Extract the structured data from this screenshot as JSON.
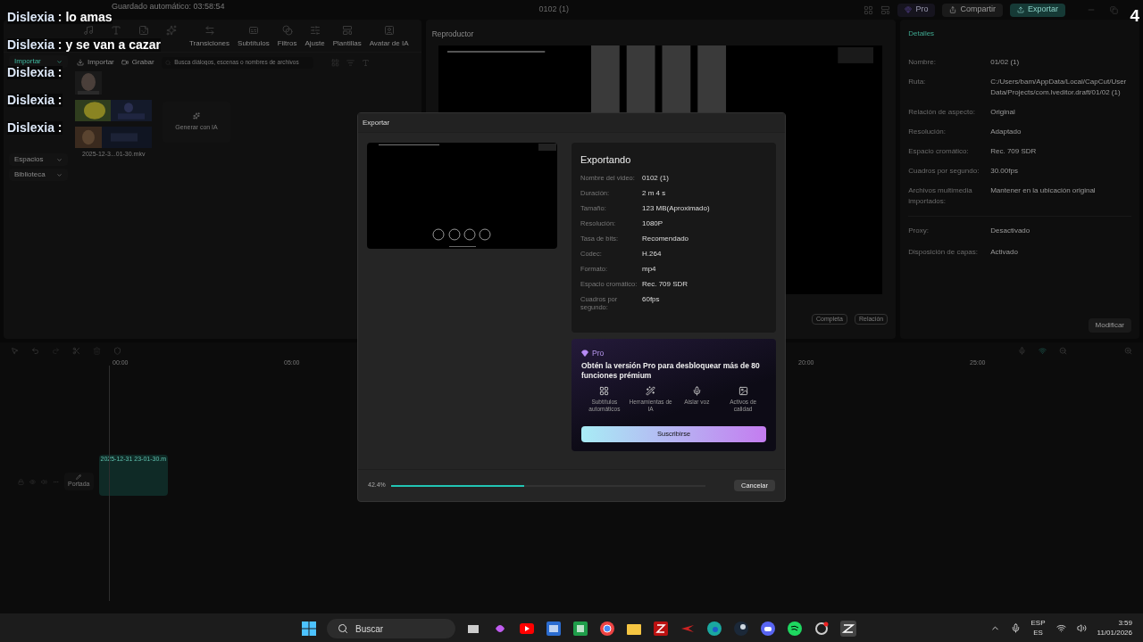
{
  "chat_overlay": [
    {
      "name": "Dislexia",
      "text": ": lo amas"
    },
    {
      "name": "Dislexia",
      "text": ": y se van a cazar"
    },
    {
      "name": "Dislexia",
      "text": ":"
    },
    {
      "name": "Dislexia",
      "text": ":"
    },
    {
      "name": "Dislexia",
      "text": ":"
    }
  ],
  "corner_badge": "4",
  "title_bar": {
    "autosave": "Guardado automático: 03:58:54",
    "project": "0102 (1)",
    "pro": "Pro",
    "share": "Compartir",
    "export": "Exportar"
  },
  "left_panel": {
    "tabs": [
      {
        "label": "Transiciones"
      },
      {
        "label": "Subtítulos"
      },
      {
        "label": "Filtros"
      },
      {
        "label": "Ajuste"
      },
      {
        "label": "Plantillas"
      },
      {
        "label": "Avatar de IA"
      }
    ],
    "sidebar": [
      {
        "label": "Importar",
        "selected": true
      },
      {
        "label": "Espacios",
        "selected": false
      },
      {
        "label": "Biblioteca",
        "selected": false
      }
    ],
    "import_button": "Importar",
    "record_button": "Grabar",
    "search": {
      "placeholder": "Busca diálogos, escenas o nombres de archivos"
    },
    "media": [
      {
        "kind": "picture"
      },
      {
        "kind": "picture"
      },
      {
        "kind": "picture",
        "caption": "2025-12-3...01-30.mkv"
      }
    ],
    "generate_tile": "Generar con IA"
  },
  "player": {
    "title": "Reproductor",
    "buttons": [
      "Completa",
      "Relación"
    ]
  },
  "details": {
    "title": "Detalles",
    "rows": [
      {
        "label": "Nombre:",
        "value": "01/02 (1)"
      },
      {
        "label": "Ruta:",
        "value": "C:/Users/bam/AppData/Local/CapCut/User Data/Projects/com.lveditor.draft/01/02 (1)"
      },
      {
        "label": "Relación de aspecto:",
        "value": "Original"
      },
      {
        "label": "Resolución:",
        "value": "Adaptado"
      },
      {
        "label": "Espacio cromático:",
        "value": "Rec. 709 SDR"
      },
      {
        "label": "Cuadros por segundo:",
        "value": "30.00fps"
      },
      {
        "label": "Archivos multimedia importados:",
        "value": "Mantener en la ubicación original"
      }
    ],
    "extra_rows": [
      {
        "label": "Proxy:",
        "value": "Desactivado"
      },
      {
        "label": "Disposición de capas:",
        "value": "Activado"
      }
    ],
    "modify_button": "Modificar"
  },
  "timeline": {
    "ruler": [
      {
        "label": "00:00"
      },
      {
        "label": "05:00"
      },
      {
        "label": "20:00"
      },
      {
        "label": "25:00"
      }
    ],
    "cover_button": "Portada",
    "clip": "2025-12-31 23-01-30.m"
  },
  "export_dialog": {
    "title": "Exportar",
    "heading": "Exportando",
    "info": [
      {
        "label": "Nombre del video:",
        "value": "0102 (1)"
      },
      {
        "label": "Duración:",
        "value": "2 m 4 s"
      },
      {
        "label": "Tamaño:",
        "value": "123 MB(Aproximado)"
      },
      {
        "label": "Resolución:",
        "value": "1080P"
      },
      {
        "label": "Tasa de bits:",
        "value": "Recomendado"
      },
      {
        "label": "Codec:",
        "value": "H.264"
      },
      {
        "label": "Formato:",
        "value": "mp4"
      },
      {
        "label": "Espacio cromático:",
        "value": "Rec. 709 SDR"
      },
      {
        "label": "Cuadros por segundo:",
        "value": "60fps"
      }
    ],
    "pro": {
      "badge": "Pro",
      "headline": "Obtén la versión Pro para desbloquear más de 80 funciones prémium",
      "features": [
        "Subtítulos automáticos",
        "Herramientas de IA",
        "Aislar voz",
        "Activos de calidad"
      ],
      "subscribe": "Suscribirse"
    },
    "progress": {
      "reading": "42.4%",
      "level": 0.424
    },
    "cancel": "Cancelar"
  },
  "taskbar": {
    "search": "Buscar",
    "lang": "ESP",
    "layout": "ES",
    "time": "3:59",
    "date": "11/01/2026"
  }
}
